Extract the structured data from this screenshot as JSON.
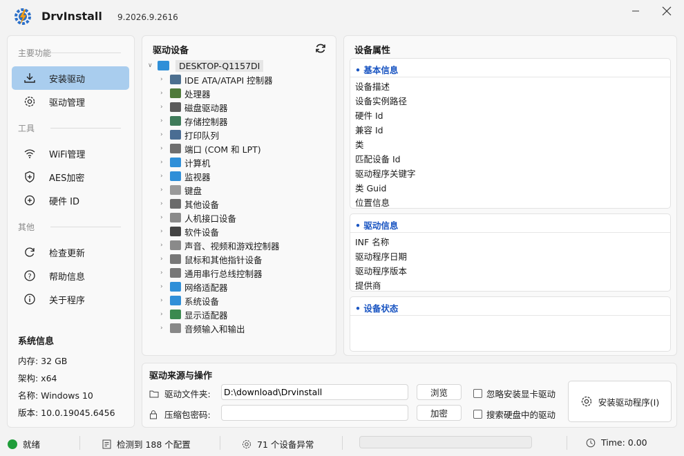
{
  "app": {
    "name": "DrvInstall",
    "version": "9.2026.9.2616"
  },
  "sidebar": {
    "sections": {
      "main": "主要功能",
      "tools": "工具",
      "other": "其他"
    },
    "items": [
      {
        "label": "安装驱动",
        "icon": "download-icon"
      },
      {
        "label": "驱动管理",
        "icon": "gear-icon"
      },
      {
        "label": "WiFi管理",
        "icon": "wifi-icon"
      },
      {
        "label": "AES加密",
        "icon": "shield-plus-icon"
      },
      {
        "label": "硬件 ID",
        "icon": "hardware-id-icon"
      },
      {
        "label": "检查更新",
        "icon": "refresh-icon"
      },
      {
        "label": "帮助信息",
        "icon": "help-icon"
      },
      {
        "label": "关于程序",
        "icon": "info-icon"
      }
    ],
    "sysinfo": {
      "title": "系统信息",
      "rows": [
        "内存: 32 GB",
        "架构: x64",
        "名称: Windows 10",
        "版本: 10.0.19045.6456"
      ]
    }
  },
  "devices": {
    "title": "驱动设备",
    "root": "DESKTOP-Q1157DI",
    "items": [
      {
        "label": "IDE ATA/ATAPI 控制器",
        "color": "#4c6f8f"
      },
      {
        "label": "处理器",
        "color": "#4f7a3a"
      },
      {
        "label": "磁盘驱动器",
        "color": "#5b5b5b"
      },
      {
        "label": "存储控制器",
        "color": "#3f7b5a"
      },
      {
        "label": "打印队列",
        "color": "#4a6d93"
      },
      {
        "label": "端口 (COM 和 LPT)",
        "color": "#6f6f6f"
      },
      {
        "label": "计算机",
        "color": "#2f8fd8"
      },
      {
        "label": "监视器",
        "color": "#2f8fd8"
      },
      {
        "label": "键盘",
        "color": "#9a9a9a"
      },
      {
        "label": "其他设备",
        "color": "#6b6b6b"
      },
      {
        "label": "人机接口设备",
        "color": "#8a8a8a"
      },
      {
        "label": "软件设备",
        "color": "#444444"
      },
      {
        "label": "声音、视频和游戏控制器",
        "color": "#8a8a8a"
      },
      {
        "label": "鼠标和其他指针设备",
        "color": "#777777"
      },
      {
        "label": "通用串行总线控制器",
        "color": "#777777"
      },
      {
        "label": "网络适配器",
        "color": "#2f8fd8"
      },
      {
        "label": "系统设备",
        "color": "#2f8fd8"
      },
      {
        "label": "显示适配器",
        "color": "#3b8a4f"
      },
      {
        "label": "音频输入和输出",
        "color": "#888888"
      }
    ]
  },
  "properties": {
    "title": "设备属性",
    "basic": {
      "title": "• 基本信息",
      "rows": [
        "设备描述",
        "设备实例路径",
        "硬件 Id",
        "兼容 Id",
        "类",
        "匹配设备 Id",
        "驱动程序关键字",
        "类 Guid",
        "位置信息"
      ]
    },
    "driver": {
      "title": "• 驱动信息",
      "rows": [
        "INF 名称",
        "驱动程序日期",
        "驱动程序版本",
        "提供商"
      ]
    },
    "status": {
      "title": "• 设备状态"
    }
  },
  "source": {
    "title": "驱动来源与操作",
    "folder_label": "驱动文件夹:",
    "folder_value": "D:\\download\\Drvinstall",
    "password_label": "压缩包密码:",
    "password_value": "",
    "browse_label": "浏览",
    "encrypt_label": "加密",
    "skip_gpu_label": "忽略安装显卡驱动",
    "search_disk_label": "搜索硬盘中的驱动",
    "install_label": "安装驱动程序(I)"
  },
  "status": {
    "ready": "就绪",
    "configs": "检测到 188 个配置",
    "abnormal": "71 个设备异常",
    "time": "Time: 0.00",
    "progress": 0,
    "ready_color": "#1f9d3a"
  }
}
